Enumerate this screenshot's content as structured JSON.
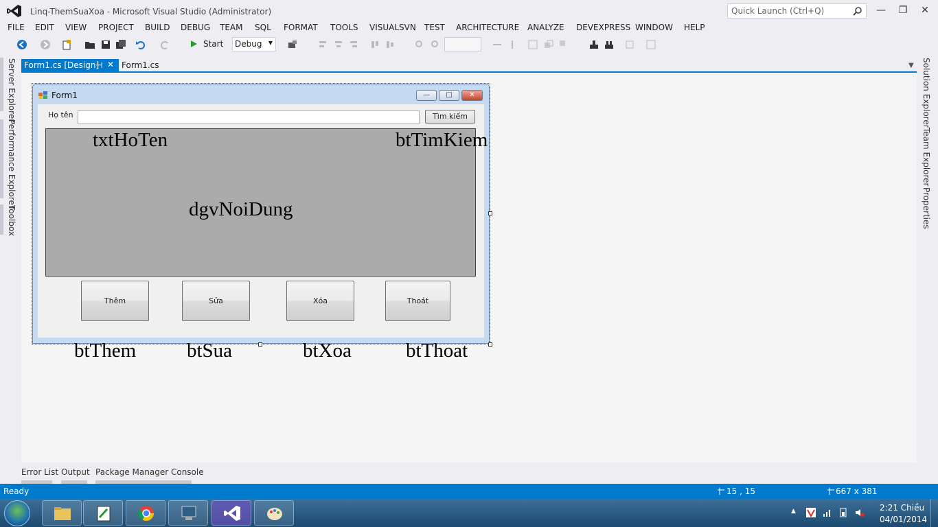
{
  "window": {
    "title": "Linq-ThemSuaXoa - Microsoft Visual Studio (Administrator)",
    "quick_launch_placeholder": "Quick Launch (Ctrl+Q)",
    "minimize": "—",
    "restore": "❐",
    "close": "✕"
  },
  "menu": [
    "FILE",
    "EDIT",
    "VIEW",
    "PROJECT",
    "BUILD",
    "DEBUG",
    "TEAM",
    "SQL",
    "FORMAT",
    "TOOLS",
    "VISUALSVN",
    "TEST",
    "ARCHITECTURE",
    "ANALYZE",
    "DEVEXPRESS",
    "WINDOW",
    "HELP"
  ],
  "toolbar": {
    "start_label": "Start",
    "config_value": "Debug"
  },
  "left_tool_tabs": [
    "Server Explorer",
    "Performance Explorer",
    "Toolbox"
  ],
  "right_tool_tabs": [
    "Solution Explorer",
    "Team Explorer",
    "Properties"
  ],
  "doc_tabs": {
    "active": "Form1.cs [Design]",
    "inactive": "Form1.cs",
    "pin": "⊣",
    "close": "✕",
    "overflow": "▼"
  },
  "form": {
    "caption": "Form1",
    "label_hoten": "Họ tên",
    "search_button": "Tìm kiếm",
    "buttons": {
      "them": "Thêm",
      "sua": "Sửa",
      "xoa": "Xóa",
      "thoat": "Thoát"
    }
  },
  "annotations": {
    "txt": "txtHoTen",
    "btsearch": "btTimKiem",
    "dgv": "dgvNoiDung",
    "bthem": "btThem",
    "btsua": "btSua",
    "btxoa": "btXoa",
    "btthoat": "btThoat"
  },
  "bottom_tabs": [
    "Error List",
    "Output",
    "Package Manager Console"
  ],
  "status": {
    "ready": "Ready",
    "position": "15 , 15",
    "size": "667 x 381"
  },
  "taskbar": {
    "time": "2:21 Chiều",
    "date": "04/01/2014"
  },
  "colors": {
    "accent": "#007acc",
    "taskbar": "#1c4a70",
    "vs_purple": "#68217a"
  }
}
